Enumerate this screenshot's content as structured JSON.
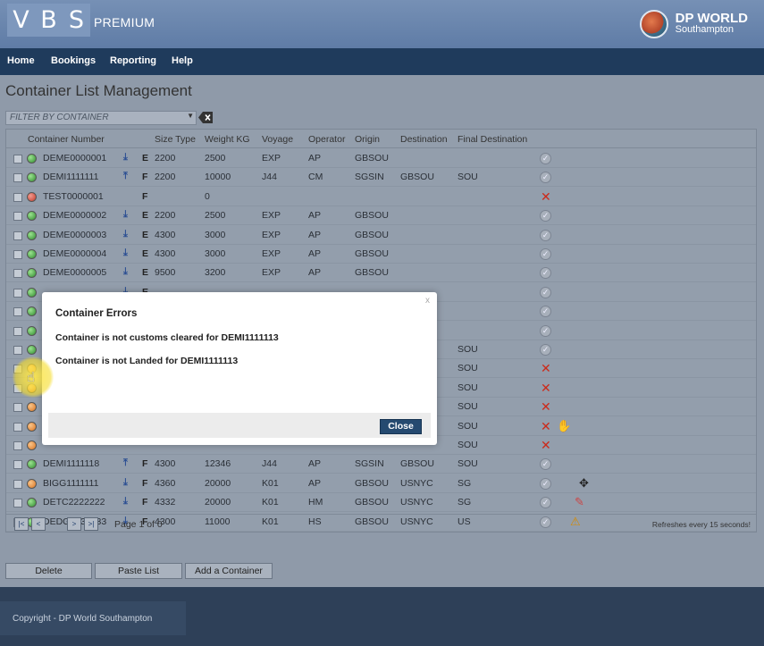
{
  "app": {
    "logo_letters": [
      "V",
      "B",
      "S"
    ],
    "edition": "PREMIUM",
    "brand_name": "DP WORLD",
    "brand_sub": "Southampton"
  },
  "nav": [
    "Home",
    "Bookings",
    "Reporting",
    "Help"
  ],
  "page": {
    "title": "Container List Management",
    "filter_placeholder": "FILTER BY CONTAINER"
  },
  "columns": [
    "Container Number",
    "Size Type",
    "Weight KG",
    "Voyage",
    "Operator",
    "Origin",
    "Destination",
    "Final Destination"
  ],
  "rows": [
    {
      "status": "green",
      "number": "DEME0000001",
      "dir": "down",
      "ef": "E",
      "size": "2200",
      "weight": "2500",
      "voyage": "EXP",
      "operator": "AP",
      "origin": "GBSOU",
      "dest": "",
      "final": "",
      "state": "ok",
      "extra": ""
    },
    {
      "status": "green",
      "number": "DEMI1111111",
      "dir": "up",
      "ef": "F",
      "size": "2200",
      "weight": "10000",
      "voyage": "J44",
      "operator": "CM",
      "origin": "SGSIN",
      "dest": "GBSOU",
      "final": "SOU",
      "state": "ok",
      "extra": ""
    },
    {
      "status": "red",
      "number": "TEST0000001",
      "dir": "",
      "ef": "F",
      "size": "",
      "weight": "0",
      "voyage": "",
      "operator": "",
      "origin": "",
      "dest": "",
      "final": "",
      "state": "error",
      "extra": ""
    },
    {
      "status": "green",
      "number": "DEME0000002",
      "dir": "down",
      "ef": "E",
      "size": "2200",
      "weight": "2500",
      "voyage": "EXP",
      "operator": "AP",
      "origin": "GBSOU",
      "dest": "",
      "final": "",
      "state": "ok",
      "extra": ""
    },
    {
      "status": "green",
      "number": "DEME0000003",
      "dir": "down",
      "ef": "E",
      "size": "4300",
      "weight": "3000",
      "voyage": "EXP",
      "operator": "AP",
      "origin": "GBSOU",
      "dest": "",
      "final": "",
      "state": "ok",
      "extra": ""
    },
    {
      "status": "green",
      "number": "DEME0000004",
      "dir": "down",
      "ef": "E",
      "size": "4300",
      "weight": "3000",
      "voyage": "EXP",
      "operator": "AP",
      "origin": "GBSOU",
      "dest": "",
      "final": "",
      "state": "ok",
      "extra": ""
    },
    {
      "status": "green",
      "number": "DEME0000005",
      "dir": "down",
      "ef": "E",
      "size": "9500",
      "weight": "3200",
      "voyage": "EXP",
      "operator": "AP",
      "origin": "GBSOU",
      "dest": "",
      "final": "",
      "state": "ok",
      "extra": ""
    },
    {
      "status": "green",
      "number": "",
      "dir": "down",
      "ef": "E",
      "size": "",
      "weight": "",
      "voyage": "",
      "operator": "",
      "origin": "",
      "dest": "",
      "final": "",
      "state": "ok",
      "extra": ""
    },
    {
      "status": "green",
      "number": "",
      "dir": "",
      "ef": "",
      "size": "",
      "weight": "",
      "voyage": "",
      "operator": "",
      "origin": "",
      "dest": "",
      "final": "",
      "state": "ok",
      "extra": ""
    },
    {
      "status": "green",
      "number": "",
      "dir": "",
      "ef": "",
      "size": "",
      "weight": "",
      "voyage": "",
      "operator": "",
      "origin": "",
      "dest": "",
      "final": "",
      "state": "ok",
      "extra": ""
    },
    {
      "status": "green",
      "number": "",
      "dir": "",
      "ef": "",
      "size": "",
      "weight": "",
      "voyage": "",
      "operator": "",
      "origin": "",
      "dest": "",
      "final": "SOU",
      "state": "ok",
      "extra": ""
    },
    {
      "status": "orange",
      "number": "",
      "dir": "",
      "ef": "",
      "size": "",
      "weight": "",
      "voyage": "",
      "operator": "",
      "origin": "",
      "dest": "",
      "final": "SOU",
      "state": "error",
      "extra": ""
    },
    {
      "status": "orange",
      "number": "",
      "dir": "",
      "ef": "",
      "size": "",
      "weight": "",
      "voyage": "",
      "operator": "",
      "origin": "",
      "dest": "",
      "final": "SOU",
      "state": "error",
      "extra": ""
    },
    {
      "status": "orange",
      "number": "",
      "dir": "",
      "ef": "",
      "size": "",
      "weight": "",
      "voyage": "",
      "operator": "",
      "origin": "",
      "dest": "",
      "final": "SOU",
      "state": "error",
      "extra": ""
    },
    {
      "status": "orange",
      "number": "",
      "dir": "",
      "ef": "",
      "size": "",
      "weight": "",
      "voyage": "",
      "operator": "",
      "origin": "",
      "dest": "",
      "final": "SOU",
      "state": "error",
      "extra": "hand"
    },
    {
      "status": "orange",
      "number": "",
      "dir": "",
      "ef": "",
      "size": "",
      "weight": "",
      "voyage": "",
      "operator": "",
      "origin": "",
      "dest": "",
      "final": "SOU",
      "state": "error",
      "extra": ""
    },
    {
      "status": "green",
      "number": "DEMI1111118",
      "dir": "up",
      "ef": "F",
      "size": "4300",
      "weight": "12346",
      "voyage": "J44",
      "operator": "AP",
      "origin": "SGSIN",
      "dest": "GBSOU",
      "final": "SOU",
      "state": "ok",
      "extra": ""
    },
    {
      "status": "orange",
      "number": "BIGG1111111",
      "dir": "down",
      "ef": "F",
      "size": "4360",
      "weight": "20000",
      "voyage": "K01",
      "operator": "AP",
      "origin": "GBSOU",
      "dest": "USNYC",
      "final": "SG",
      "state": "ok",
      "extra": "move"
    },
    {
      "status": "green",
      "number": "DETC2222222",
      "dir": "down",
      "ef": "F",
      "size": "4332",
      "weight": "20000",
      "voyage": "K01",
      "operator": "HM",
      "origin": "GBSOU",
      "dest": "USNYC",
      "final": "SG",
      "state": "ok",
      "extra": "pencil"
    },
    {
      "status": "green",
      "number": "DEDG3333333",
      "dir": "down",
      "ef": "F",
      "size": "4300",
      "weight": "11000",
      "voyage": "K01",
      "operator": "HS",
      "origin": "GBSOU",
      "dest": "USNYC",
      "final": "US",
      "state": "ok",
      "extra": "warning"
    }
  ],
  "pager": {
    "first": "|<",
    "prev": "<",
    "next": ">",
    "last": ">|",
    "text": "Page 1 of 0",
    "refresh": "Refreshes every 15 seconds!"
  },
  "buttons": {
    "delete": "Delete",
    "paste": "Paste List",
    "add": "Add a Container"
  },
  "footer": {
    "copyright": "Copyright - DP World Southampton"
  },
  "modal": {
    "title": "Container Errors",
    "messages": [
      "Container is not customs cleared for DEMI1111113",
      "Container is not Landed for DEMI1111113"
    ],
    "close_label": "Close",
    "close_x": "x"
  },
  "icons": {
    "row_ok": "check-circle-icon",
    "row_error": "red-x-icon",
    "arrow_down": "download-arrow-icon",
    "arrow_up": "upload-arrow-icon"
  },
  "colors": {
    "nav_bg": "#1f3b5c",
    "topbar": "#6a86ad",
    "close_button": "#254a70",
    "error": "#cc2a1a"
  }
}
